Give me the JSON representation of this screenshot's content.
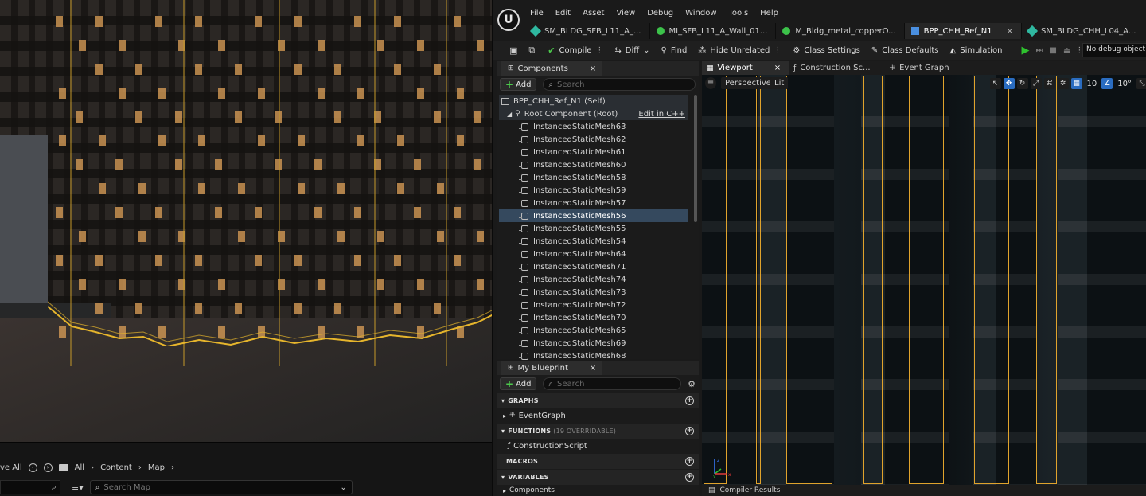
{
  "content_browser": {
    "save_all": "ve All",
    "path": [
      "All",
      "Content",
      "Map"
    ],
    "search_placeholder": "Search Map"
  },
  "menu": [
    "File",
    "Edit",
    "Asset",
    "View",
    "Debug",
    "Window",
    "Tools",
    "Help"
  ],
  "tabs": [
    {
      "label": "SM_BLDG_SFB_L11_A_...",
      "color": "#2fb8a0"
    },
    {
      "label": "MI_SFB_L11_A_Wall_01...",
      "color": "#3cc24a"
    },
    {
      "label": "M_Bldg_metal_copperO...",
      "color": "#3cc24a"
    },
    {
      "label": "BPP_CHH_Ref_N1",
      "color": "#4a8fe0",
      "close": "×"
    },
    {
      "label": "SM_BLDG_CHH_L04_A...",
      "color": "#2fb8a0"
    }
  ],
  "toolbar": {
    "compile": "Compile",
    "diff": "Diff",
    "find": "Find",
    "hide_unrelated": "Hide Unrelated",
    "class_settings": "Class Settings",
    "class_defaults": "Class Defaults",
    "simulation": "Simulation",
    "debug_object": "No debug object selected"
  },
  "components": {
    "title": "Components",
    "close": "×",
    "add": "Add",
    "search_placeholder": "Search",
    "self": "BPP_CHH_Ref_N1 (Self)",
    "root": "Root Component (Root)",
    "edit_cpp": "Edit in C++",
    "items": [
      "InstancedStaticMesh63",
      "InstancedStaticMesh62",
      "InstancedStaticMesh61",
      "InstancedStaticMesh60",
      "InstancedStaticMesh58",
      "InstancedStaticMesh59",
      "InstancedStaticMesh57",
      "InstancedStaticMesh56",
      "InstancedStaticMesh55",
      "InstancedStaticMesh54",
      "InstancedStaticMesh64",
      "InstancedStaticMesh71",
      "InstancedStaticMesh74",
      "InstancedStaticMesh73",
      "InstancedStaticMesh72",
      "InstancedStaticMesh70",
      "InstancedStaticMesh65",
      "InstancedStaticMesh69",
      "InstancedStaticMesh68"
    ],
    "selected": "InstancedStaticMesh56"
  },
  "my_blueprint": {
    "title": "My Blueprint",
    "close": "×",
    "add": "Add",
    "search_placeholder": "Search",
    "graphs": "GRAPHS",
    "event_graph": "EventGraph",
    "functions": "FUNCTIONS",
    "functions_sub": "(19 OVERRIDABLE)",
    "construction_script": "ConstructionScript",
    "macros": "MACROS",
    "variables": "VARIABLES",
    "components_cat": "Components"
  },
  "viewport": {
    "tabs": [
      {
        "label": "Viewport",
        "close": "×"
      },
      {
        "label": "Construction Sc..."
      },
      {
        "label": "Event Graph"
      }
    ],
    "perspective": "Perspective",
    "lit": "Lit",
    "grid_snap": "10",
    "rot_snap": "10°",
    "axis_z": "z",
    "axis_y": "y",
    "axis_x": "x",
    "compiler_results": "Compiler Results",
    "highlight_color": "#e0a32c"
  }
}
